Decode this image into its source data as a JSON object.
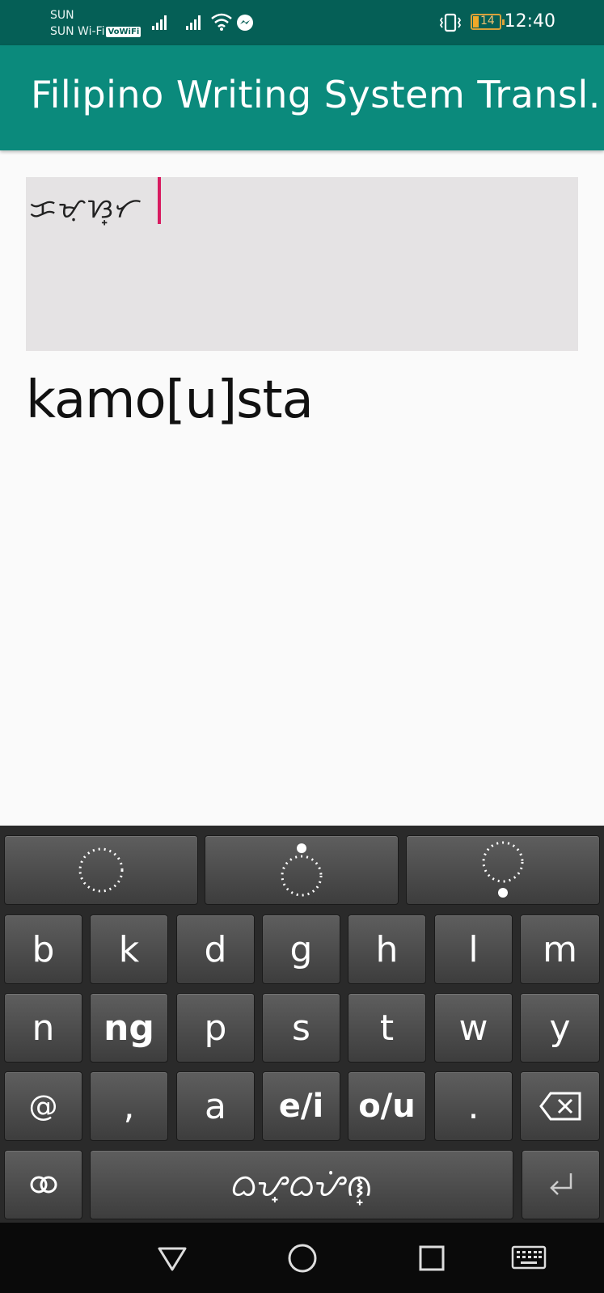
{
  "status_bar": {
    "carrier_line1": "SUN",
    "carrier_line2": "SUN Wi-Fi",
    "vowifi_badge": "VoWiFi",
    "battery_level": "14",
    "time": "12:40",
    "icons": [
      "signal-icon",
      "signal-icon",
      "wifi-icon",
      "messenger-icon",
      "vibrate-icon",
      "battery-icon"
    ]
  },
  "app_bar": {
    "title": "Filipino Writing System Transl..."
  },
  "input": {
    "baybayin_text": "ᜃᜋᜓᜐ᜔ᜆ",
    "bg_color": "#e5e3e4",
    "cursor_color": "#d81b60"
  },
  "output": {
    "latin_text": "kamo[u]sta"
  },
  "keyboard": {
    "diacritic_row": [
      "vowel-mark-none-icon",
      "vowel-mark-above-icon",
      "vowel-mark-below-icon"
    ],
    "row1": [
      "b",
      "k",
      "d",
      "g",
      "h",
      "l",
      "m"
    ],
    "row2": [
      "n",
      "ng",
      "p",
      "s",
      "t",
      "w",
      "y"
    ],
    "row3": [
      "@",
      ",",
      "a",
      "e/i",
      "o/u",
      ".",
      "backspace-icon"
    ],
    "row4": {
      "left_icon": "link-icon",
      "space_label": "ᜊᜌ᜔ᜊᜌᜒᜈ᜔",
      "enter_icon": "enter-icon"
    }
  },
  "nav_bar": {
    "icons": [
      "back-icon",
      "home-icon",
      "recents-icon",
      "keyboard-icon"
    ]
  },
  "colors": {
    "status_bar": "#055f56",
    "app_bar": "#0b8a7c",
    "keyboard_bg": "#2a2a2a"
  }
}
